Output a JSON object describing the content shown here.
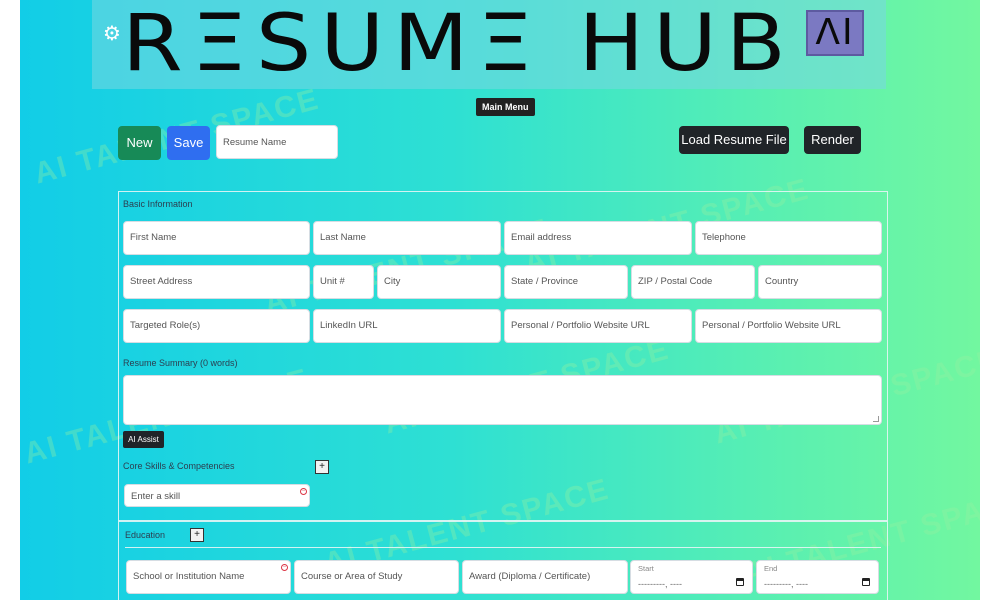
{
  "header": {
    "logo_text": "RΞSUMΞ HUB",
    "ai_badge": "ΛI",
    "main_menu_label": "Main Menu"
  },
  "toolbar": {
    "new_label": "New",
    "save_label": "Save",
    "resume_name_placeholder": "Resume Name",
    "load_label": "Load Resume File",
    "render_label": "Render"
  },
  "basic_info": {
    "section_label": "Basic Information",
    "first_name": "First Name",
    "last_name": "Last Name",
    "email": "Email address",
    "telephone": "Telephone",
    "street": "Street Address",
    "unit": "Unit #",
    "city": "City",
    "state": "State / Province",
    "zip": "ZIP / Postal Code",
    "country": "Country",
    "targeted_roles": "Targeted Role(s)",
    "linkedin": "LinkedIn URL",
    "website1": "Personal / Portfolio Website URL",
    "website2": "Personal / Portfolio Website URL",
    "summary_label": "Resume Summary (0 words)",
    "ai_assist_label": "AI Assist",
    "skills_label": "Core Skills & Competencies",
    "skill_placeholder": "Enter a skill"
  },
  "education": {
    "section_label": "Education",
    "school": "School or Institution Name",
    "course": "Course or Area of Study",
    "award": "Award (Diploma / Certificate)",
    "start_label": "Start",
    "start_value": "---------, ----",
    "end_label": "End",
    "end_value": "---------, ----"
  },
  "watermark_text": "AI TALENT SPACE",
  "plus_glyph": "+",
  "colors": {
    "new_button": "#178a57",
    "save_button": "#2f6ef0",
    "dark_button": "#202428",
    "ai_badge": "#7b79c2"
  }
}
